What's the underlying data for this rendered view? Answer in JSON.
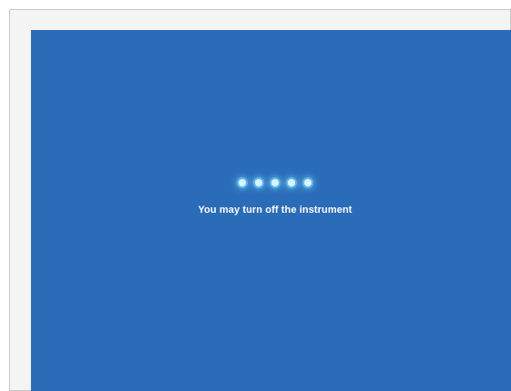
{
  "screen": {
    "background_color": "#2b6cb9",
    "message": "You may turn off the instrument"
  },
  "loader": {
    "dots": 5,
    "dot_color": "#d7f6ff",
    "glow_color": "#87dcff"
  }
}
